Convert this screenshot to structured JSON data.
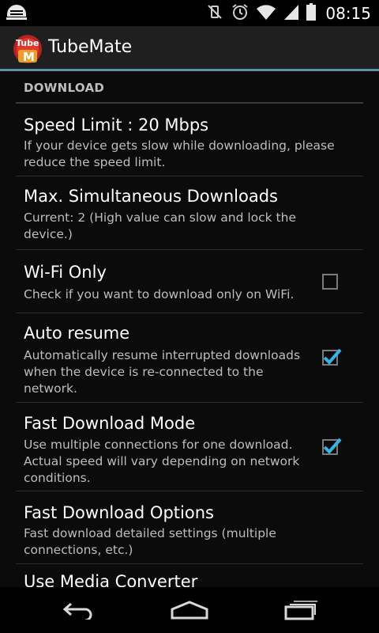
{
  "status_bar": {
    "time": "08:15",
    "icons": [
      "notification-icon",
      "vibrate-icon",
      "alarm-icon",
      "wifi-icon",
      "signal-icon",
      "battery-icon"
    ]
  },
  "action_bar": {
    "app_title": "TubeMate",
    "logo": {
      "top_text": "Tube",
      "letter": "M"
    }
  },
  "section": {
    "header": "DOWNLOAD"
  },
  "preferences": [
    {
      "title": "Speed Limit : 20 Mbps",
      "summary": "If your device gets slow while downloading, please reduce the speed limit."
    },
    {
      "title": "Max. Simultaneous Downloads",
      "summary": "Current: 2 (High value can slow and lock the device.)"
    },
    {
      "title": "Wi-Fi Only",
      "summary": "Check if you want to download only on WiFi.",
      "checked": false
    },
    {
      "title": "Auto resume",
      "summary": "Automatically resume interrupted downloads when the device is re-connected to the network.",
      "checked": true
    },
    {
      "title": "Fast Download Mode",
      "summary": "Use multiple connections for one download. Actual speed will vary depending on network conditions.",
      "checked": true
    },
    {
      "title": "Fast Download Options",
      "summary": "Fast download detailed settings (multiple connections, etc.)"
    },
    {
      "title": "Use Media Converter"
    }
  ],
  "nav_bar": {
    "buttons": [
      "back-icon",
      "home-icon",
      "recent-apps-icon"
    ]
  },
  "colors": {
    "accent": "#33b5e5",
    "action_bar_border": "#5f8fab"
  }
}
